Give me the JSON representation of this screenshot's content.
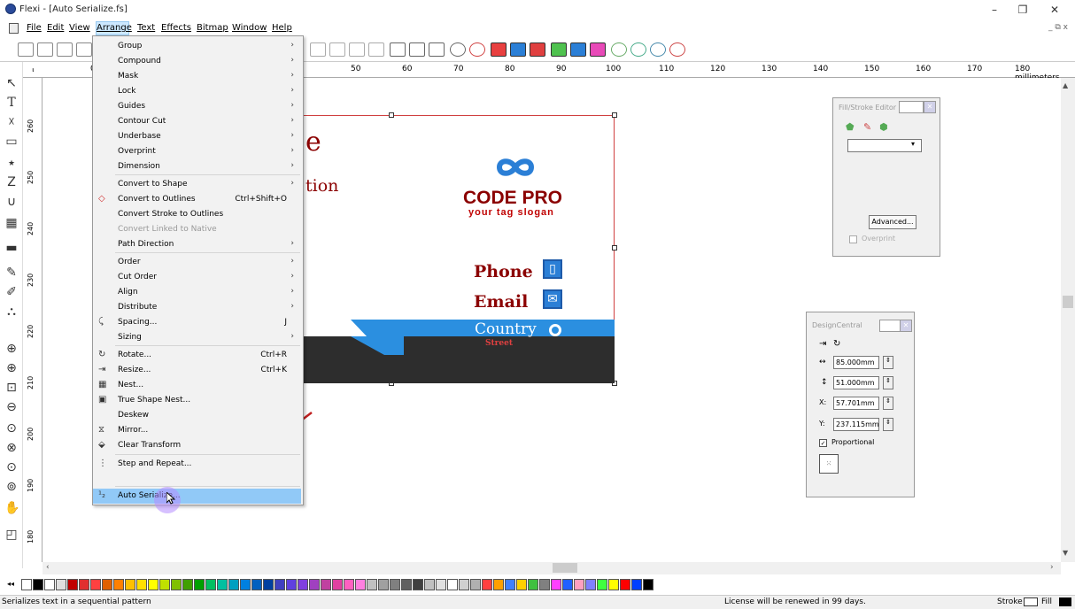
{
  "window": {
    "title": "Flexi - [Auto Serialize.fs]",
    "minimize": "–",
    "maximize": "❐",
    "close": "✕",
    "mdi_controls": "_ ⧉ x"
  },
  "menubar": {
    "items": [
      "File",
      "Edit",
      "View",
      "Arrange",
      "Text",
      "Effects",
      "Bitmap",
      "Window",
      "Help"
    ]
  },
  "ruler_h": {
    "labels": [
      "0",
      "50",
      "60",
      "70",
      "80",
      "90",
      "100",
      "110",
      "120",
      "130",
      "140",
      "150",
      "160",
      "170",
      "180 millimeters"
    ]
  },
  "ruler_v": {
    "labels": [
      "260",
      "250",
      "240",
      "230",
      "220",
      "210",
      "200",
      "190",
      "180"
    ]
  },
  "arrange_menu": [
    {
      "label": "Group",
      "submenu": true
    },
    {
      "label": "Compound",
      "submenu": true
    },
    {
      "label": "Mask",
      "submenu": true
    },
    {
      "label": "Lock",
      "submenu": true
    },
    {
      "label": "Guides",
      "submenu": true
    },
    {
      "label": "Contour Cut",
      "submenu": true
    },
    {
      "label": "Underbase",
      "submenu": true
    },
    {
      "label": "Overprint",
      "submenu": true
    },
    {
      "label": "Dimension",
      "submenu": true
    },
    {
      "label": "Convert to Shape",
      "submenu": true
    },
    {
      "label": "Convert to Outlines",
      "shortcut": "Ctrl+Shift+O",
      "icon": "outline-icon"
    },
    {
      "label": "Convert Stroke to Outlines"
    },
    {
      "label": "Convert Linked to Native",
      "disabled": true
    },
    {
      "label": "Path Direction",
      "submenu": true
    },
    {
      "label": "Order",
      "submenu": true
    },
    {
      "label": "Cut Order",
      "submenu": true
    },
    {
      "label": "Align",
      "submenu": true
    },
    {
      "label": "Distribute",
      "submenu": true
    },
    {
      "label": "Spacing...",
      "shortcut": "J",
      "icon": "spacing-icon"
    },
    {
      "label": "Sizing",
      "submenu": true
    },
    {
      "label": "Rotate...",
      "shortcut": "Ctrl+R",
      "icon": "rotate-icon"
    },
    {
      "label": "Resize...",
      "shortcut": "Ctrl+K",
      "icon": "resize-icon"
    },
    {
      "label": "Nest...",
      "icon": "nest-icon"
    },
    {
      "label": "True Shape Nest...",
      "icon": "true-shape-nest-icon"
    },
    {
      "label": "Deskew"
    },
    {
      "label": "Mirror...",
      "icon": "mirror-icon"
    },
    {
      "label": "Clear Transform",
      "icon": "clear-transform-icon"
    },
    {
      "label": "Step and Repeat...",
      "icon": "step-repeat-icon"
    },
    {
      "label": "Auto Serialize...",
      "icon": "auto-serialize-icon",
      "highlighted": true
    }
  ],
  "canvas": {
    "partial_heading": "e",
    "partial_subheading": "tion",
    "logo_text": "CODE PRO",
    "logo_slogan": "your tag slogan",
    "phone_label": "Phone",
    "email_label": "Email",
    "country_label": "Country",
    "country_sub": "Street"
  },
  "fill_stroke_editor": {
    "title": "Fill/Stroke Editor",
    "advanced_button": "Advanced...",
    "overprint_label": "Overprint"
  },
  "design_central": {
    "title": "DesignCentral",
    "width": "85.000mm",
    "height": "51.000mm",
    "x_label": "X:",
    "x": "57.701mm",
    "y_label": "Y:",
    "y": "237.115mm",
    "proportional": "Proportional"
  },
  "status": {
    "hint": "Serializes text in a sequential pattern",
    "license": "License will be renewed in 99 days.",
    "stroke_label": "Stroke",
    "fill_label": "Fill"
  },
  "colors": {
    "accent_blue": "#2b7fd6",
    "dark_red": "#8b0000",
    "menu_highlight": "#91c9f7"
  }
}
